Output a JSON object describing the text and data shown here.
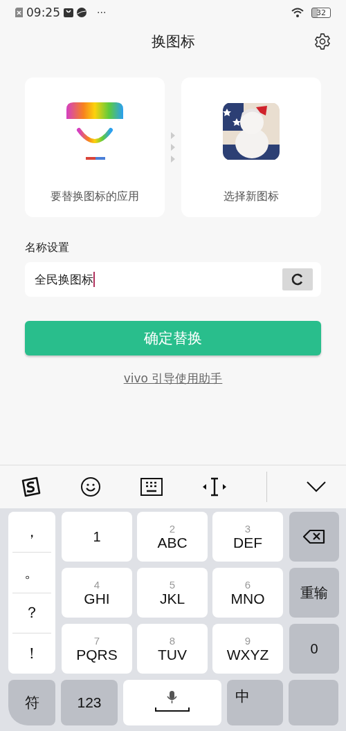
{
  "status_bar": {
    "time": "09:25",
    "overflow": "···",
    "battery": "32"
  },
  "header": {
    "title": "换图标"
  },
  "cards": [
    {
      "kind": "app",
      "label": "要替换图标的应用"
    },
    {
      "kind": "picture",
      "label": "选择新图标"
    }
  ],
  "name_setting": {
    "label": "名称设置",
    "value": "全民换图标"
  },
  "confirm_button": "确定替换",
  "helper_link": "vivo 引导使用助手",
  "keyboard": {
    "symbol_keys": [
      "，",
      "。",
      "？",
      "！"
    ],
    "keys": [
      {
        "letters": "1"
      },
      {
        "digit": "2",
        "letters": "ABC"
      },
      {
        "digit": "3",
        "letters": "DEF"
      },
      {
        "digit": "4",
        "letters": "GHI"
      },
      {
        "digit": "5",
        "letters": "JKL"
      },
      {
        "digit": "6",
        "letters": "MNO"
      },
      {
        "digit": "7",
        "letters": "PQRS"
      },
      {
        "digit": "8",
        "letters": "TUV"
      },
      {
        "digit": "9",
        "letters": "WXYZ"
      }
    ],
    "side_keys": [
      {
        "kind": "backspace"
      },
      {
        "kind": "text",
        "label": "重输"
      },
      {
        "kind": "text",
        "label": "0"
      }
    ],
    "bottom_keys": [
      {
        "kind": "text",
        "label": "符"
      },
      {
        "kind": "text",
        "label": "123"
      },
      {
        "kind": "space"
      },
      {
        "kind": "text",
        "label": "中"
      },
      {
        "kind": "blank"
      }
    ]
  }
}
